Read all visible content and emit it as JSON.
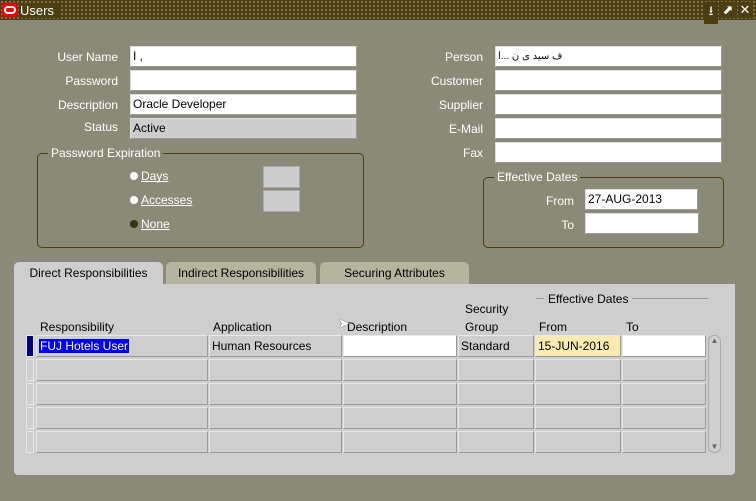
{
  "window": {
    "title": "Users",
    "buttons": [
      "minimize-icon",
      "maximize-icon",
      "close-icon"
    ]
  },
  "form": {
    "user_name": {
      "label": "User Name",
      "value": "I ,"
    },
    "password": {
      "label": "Password",
      "value": ""
    },
    "description": {
      "label": "Description",
      "value": "Oracle Developer"
    },
    "status": {
      "label": "Status",
      "value": "Active"
    },
    "person": {
      "label": "Person",
      "value": "ف سید ی ن ...ا"
    },
    "customer": {
      "label": "Customer",
      "value": ""
    },
    "supplier": {
      "label": "Supplier",
      "value": ""
    },
    "email": {
      "label": "E-Mail",
      "value": ""
    },
    "fax": {
      "label": "Fax",
      "value": ""
    }
  },
  "password_expiration": {
    "title": "Password Expiration",
    "options": [
      {
        "label": "Days",
        "selected": false
      },
      {
        "label": "Accesses",
        "selected": false
      },
      {
        "label": "None",
        "selected": true
      }
    ]
  },
  "effective_dates": {
    "title": "Effective Dates",
    "from_label": "From",
    "from": "27-AUG-2013",
    "to_label": "To",
    "to": ""
  },
  "tabs": [
    {
      "label": "Direct Responsibilities",
      "active": true
    },
    {
      "label": "Indirect Responsibilities",
      "active": false
    },
    {
      "label": "Securing Attributes",
      "active": false
    }
  ],
  "table": {
    "group_header": "Effective Dates",
    "headers": {
      "responsibility": "Responsibility",
      "application": "Application",
      "description": "Description",
      "security_group_1": "Security",
      "security_group_2": "Group",
      "from": "From",
      "to": "To"
    },
    "rows": [
      {
        "responsibility": "FUJ Hotels User",
        "application": "Human Resources",
        "description": "",
        "security_group": "Standard",
        "from": "15-JUN-2016",
        "to": ""
      },
      {
        "responsibility": "",
        "application": "",
        "description": "",
        "security_group": "",
        "from": "",
        "to": ""
      },
      {
        "responsibility": "",
        "application": "",
        "description": "",
        "security_group": "",
        "from": "",
        "to": ""
      },
      {
        "responsibility": "",
        "application": "",
        "description": "",
        "security_group": "",
        "from": "",
        "to": ""
      },
      {
        "responsibility": "",
        "application": "",
        "description": "",
        "security_group": "",
        "from": "",
        "to": ""
      }
    ]
  },
  "colors": {
    "background": "#8b8a78",
    "titlebar": "#4a3e12",
    "selection": "#0000f0",
    "required_field": "#fcebb0"
  }
}
